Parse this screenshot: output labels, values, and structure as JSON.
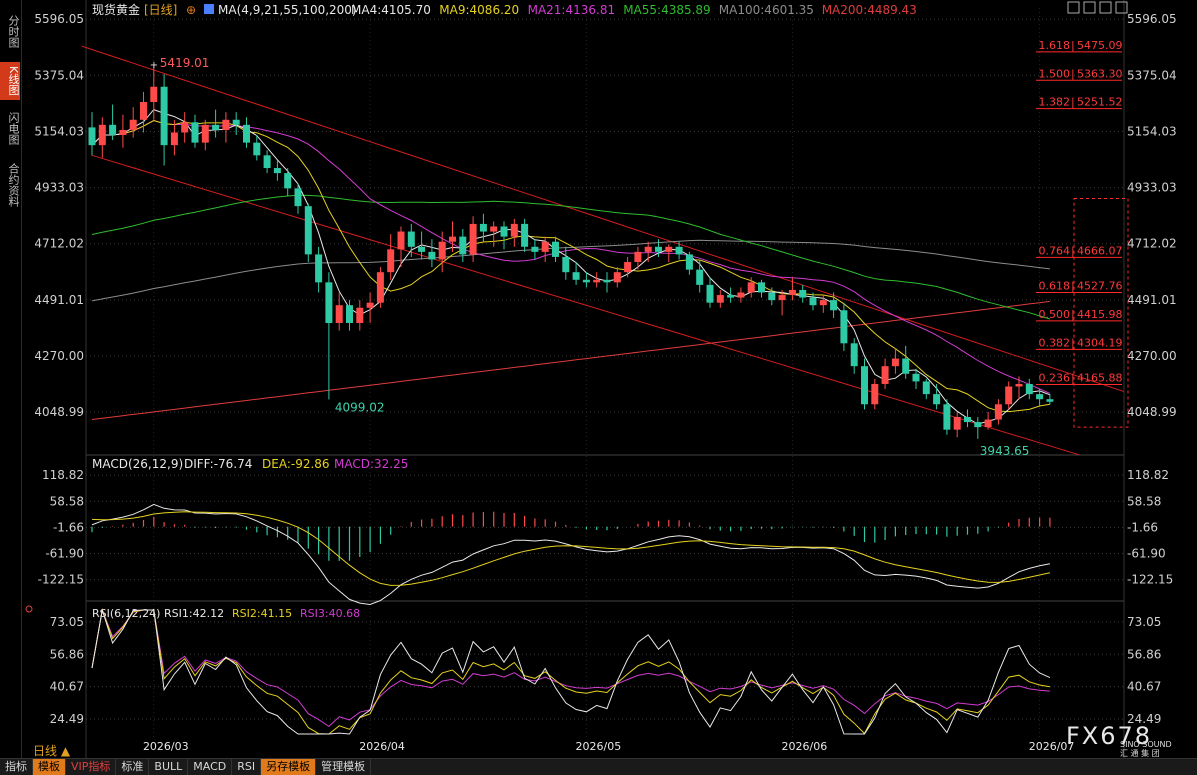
{
  "left_tabs": [
    "分时图",
    "K线图",
    "闪电图",
    "合约资料"
  ],
  "header": {
    "instrument": "现货黄金",
    "period_tag": "[日线]",
    "ma_params": "MA(4,9,21,55,100,200)",
    "ma_values": [
      {
        "label": "MA4:4105.70",
        "color": "#e8e8e8"
      },
      {
        "label": "MA9:4086.20",
        "color": "#e6d21e"
      },
      {
        "label": "MA21:4136.81",
        "color": "#d23cd2"
      },
      {
        "label": "MA55:4385.89",
        "color": "#2ebd2e"
      },
      {
        "label": "MA100:4601.35",
        "color": "#8c8c8c"
      },
      {
        "label": "MA200:4489.43",
        "color": "#e03c3c"
      }
    ]
  },
  "macd_header": {
    "params": "MACD(26,12,9)",
    "diff": "DIFF:-76.74",
    "dea": "DEA:-92.86",
    "macd": "MACD:32.25"
  },
  "rsi_header": {
    "params": "RSI(6,12,24)",
    "rsi1": "RSI1:42.12",
    "rsi2": "RSI2:41.15",
    "rsi3": "RSI3:40.68"
  },
  "colors": {
    "up": "#ff4a4a",
    "down": "#2ec9a5",
    "channel": "#d41e1e",
    "fib": "#ff2a2a",
    "grid": "#3a3a3a"
  },
  "price_axis": {
    "ticks": [
      "5596.05",
      "5375.04",
      "5154.03",
      "4933.03",
      "4712.02",
      "4491.01",
      "4270.00",
      "4048.99"
    ]
  },
  "macd_axis": {
    "ticks": [
      "118.82",
      "58.58",
      "-1.66",
      "-61.90",
      "-122.15"
    ]
  },
  "rsi_axis": {
    "ticks": [
      "73.05",
      "56.86",
      "40.67",
      "24.49"
    ]
  },
  "x_axis": {
    "labels": [
      "2026/03",
      "2026/04",
      "2026/05",
      "2026/06",
      "2026/07"
    ]
  },
  "annotations": {
    "high": "5419.01",
    "low1": "4099.02",
    "low2": "3943.65"
  },
  "fib_levels": [
    {
      "ratio": "1.618",
      "value": "5475.09",
      "price": 5475.09
    },
    {
      "ratio": "1.500",
      "value": "5363.30",
      "price": 5363.3
    },
    {
      "ratio": "1.382",
      "value": "5251.52",
      "price": 5251.52
    },
    {
      "ratio": "0.764",
      "value": "4666.07",
      "price": 4666.07
    },
    {
      "ratio": "0.618",
      "value": "4527.76",
      "price": 4527.76
    },
    {
      "ratio": "0.500",
      "value": "4415.98",
      "price": 4415.98
    },
    {
      "ratio": "0.382",
      "value": "4304.19",
      "price": 4304.19
    },
    {
      "ratio": "0.236",
      "value": "4165.88",
      "price": 4165.88
    }
  ],
  "period_label": "日线",
  "bottom_bar": [
    "指标",
    "模板",
    "VIP指标",
    "标准",
    "BULL",
    "MACD",
    "RSI",
    "另存模板",
    "管理模板"
  ],
  "logo": {
    "text": "FX678",
    "sub1": "SINO SOUND",
    "sub2": "汇 通 集 团"
  },
  "chart_data": {
    "type": "candlestick",
    "title": "现货黄金 [日线]",
    "dates_start": "2026-02-23",
    "x_labels": [
      "2026/03",
      "2026/04",
      "2026/05",
      "2026/06",
      "2026/07"
    ],
    "ylim": [
      3900,
      5640
    ],
    "candles": [
      [
        5170,
        5230,
        5060,
        5100
      ],
      [
        5100,
        5210,
        5050,
        5180
      ],
      [
        5180,
        5260,
        5120,
        5140
      ],
      [
        5140,
        5220,
        5090,
        5160
      ],
      [
        5160,
        5250,
        5130,
        5200
      ],
      [
        5200,
        5310,
        5150,
        5270
      ],
      [
        5270,
        5419.01,
        5200,
        5330
      ],
      [
        5330,
        5380,
        5020,
        5100
      ],
      [
        5100,
        5200,
        5060,
        5150
      ],
      [
        5150,
        5230,
        5110,
        5190
      ],
      [
        5190,
        5220,
        5090,
        5110
      ],
      [
        5110,
        5200,
        5080,
        5180
      ],
      [
        5180,
        5240,
        5130,
        5160
      ],
      [
        5160,
        5230,
        5110,
        5200
      ],
      [
        5200,
        5230,
        5140,
        5180
      ],
      [
        5180,
        5210,
        5090,
        5110
      ],
      [
        5110,
        5140,
        5040,
        5060
      ],
      [
        5060,
        5080,
        4990,
        5010
      ],
      [
        5010,
        5040,
        4960,
        4990
      ],
      [
        4990,
        5010,
        4900,
        4930
      ],
      [
        4930,
        4950,
        4830,
        4860
      ],
      [
        4860,
        4870,
        4640,
        4670
      ],
      [
        4670,
        4700,
        4520,
        4560
      ],
      [
        4560,
        4600,
        4099.02,
        4400
      ],
      [
        4400,
        4520,
        4370,
        4470
      ],
      [
        4470,
        4490,
        4370,
        4400
      ],
      [
        4400,
        4490,
        4370,
        4460
      ],
      [
        4460,
        4520,
        4400,
        4480
      ],
      [
        4480,
        4620,
        4460,
        4600
      ],
      [
        4600,
        4750,
        4570,
        4690
      ],
      [
        4690,
        4780,
        4620,
        4760
      ],
      [
        4760,
        4790,
        4660,
        4700
      ],
      [
        4700,
        4760,
        4650,
        4680
      ],
      [
        4680,
        4730,
        4620,
        4650
      ],
      [
        4650,
        4760,
        4600,
        4720
      ],
      [
        4720,
        4800,
        4680,
        4740
      ],
      [
        4740,
        4770,
        4640,
        4670
      ],
      [
        4670,
        4820,
        4640,
        4790
      ],
      [
        4790,
        4830,
        4720,
        4760
      ],
      [
        4760,
        4800,
        4700,
        4780
      ],
      [
        4780,
        4800,
        4690,
        4740
      ],
      [
        4740,
        4810,
        4700,
        4790
      ],
      [
        4790,
        4810,
        4680,
        4700
      ],
      [
        4700,
        4730,
        4650,
        4680
      ],
      [
        4680,
        4740,
        4640,
        4720
      ],
      [
        4720,
        4740,
        4640,
        4660
      ],
      [
        4660,
        4700,
        4570,
        4600
      ],
      [
        4600,
        4640,
        4550,
        4570
      ],
      [
        4570,
        4600,
        4540,
        4560
      ],
      [
        4560,
        4600,
        4540,
        4570
      ],
      [
        4570,
        4600,
        4520,
        4560
      ],
      [
        4560,
        4620,
        4540,
        4600
      ],
      [
        4600,
        4660,
        4580,
        4640
      ],
      [
        4640,
        4700,
        4610,
        4680
      ],
      [
        4680,
        4720,
        4640,
        4700
      ],
      [
        4700,
        4730,
        4660,
        4680
      ],
      [
        4680,
        4710,
        4640,
        4700
      ],
      [
        4700,
        4720,
        4650,
        4670
      ],
      [
        4670,
        4680,
        4590,
        4610
      ],
      [
        4610,
        4650,
        4520,
        4550
      ],
      [
        4550,
        4580,
        4460,
        4480
      ],
      [
        4480,
        4530,
        4460,
        4510
      ],
      [
        4510,
        4540,
        4480,
        4500
      ],
      [
        4500,
        4540,
        4480,
        4520
      ],
      [
        4520,
        4580,
        4500,
        4560
      ],
      [
        4560,
        4570,
        4500,
        4520
      ],
      [
        4520,
        4540,
        4470,
        4490
      ],
      [
        4490,
        4530,
        4430,
        4510
      ],
      [
        4510,
        4580,
        4490,
        4530
      ],
      [
        4530,
        4550,
        4480,
        4500
      ],
      [
        4500,
        4520,
        4450,
        4470
      ],
      [
        4470,
        4510,
        4440,
        4490
      ],
      [
        4490,
        4520,
        4420,
        4450
      ],
      [
        4450,
        4480,
        4290,
        4320
      ],
      [
        4320,
        4340,
        4200,
        4230
      ],
      [
        4230,
        4260,
        4060,
        4080
      ],
      [
        4080,
        4180,
        4060,
        4160
      ],
      [
        4160,
        4260,
        4140,
        4230
      ],
      [
        4230,
        4300,
        4200,
        4260
      ],
      [
        4260,
        4310,
        4180,
        4200
      ],
      [
        4200,
        4220,
        4140,
        4170
      ],
      [
        4170,
        4180,
        4100,
        4120
      ],
      [
        4120,
        4160,
        4060,
        4080
      ],
      [
        4080,
        4100,
        3960,
        3980
      ],
      [
        3980,
        4050,
        3950,
        4030
      ],
      [
        4030,
        4060,
        3990,
        4010
      ],
      [
        4010,
        4030,
        3943.65,
        3990
      ],
      [
        3990,
        4050,
        3980,
        4020
      ],
      [
        4020,
        4100,
        4000,
        4080
      ],
      [
        4080,
        4170,
        4060,
        4150
      ],
      [
        4150,
        4190,
        4100,
        4160
      ],
      [
        4160,
        4180,
        4100,
        4120
      ],
      [
        4120,
        4140,
        4070,
        4100
      ],
      [
        4100,
        4120,
        4080,
        4090
      ]
    ],
    "series": [
      {
        "name": "MA4:4105.70",
        "color": "#e8e8e8"
      },
      {
        "name": "MA9:4086.20",
        "color": "#e6d21e"
      },
      {
        "name": "MA21:4136.81",
        "color": "#d23cd2"
      },
      {
        "name": "MA55:4385.89",
        "color": "#2ebd2e"
      },
      {
        "name": "MA100:4601.35",
        "color": "#8c8c8c"
      },
      {
        "name": "MA200:4489.43",
        "color": "#e03c3c"
      }
    ],
    "channel_upper": [
      [
        5419.01,
        0
      ],
      [
        4170,
        1.0
      ]
    ],
    "macd": {
      "ylim": [
        -160,
        140
      ]
    },
    "rsi": {
      "ylim": [
        15,
        78
      ]
    }
  }
}
